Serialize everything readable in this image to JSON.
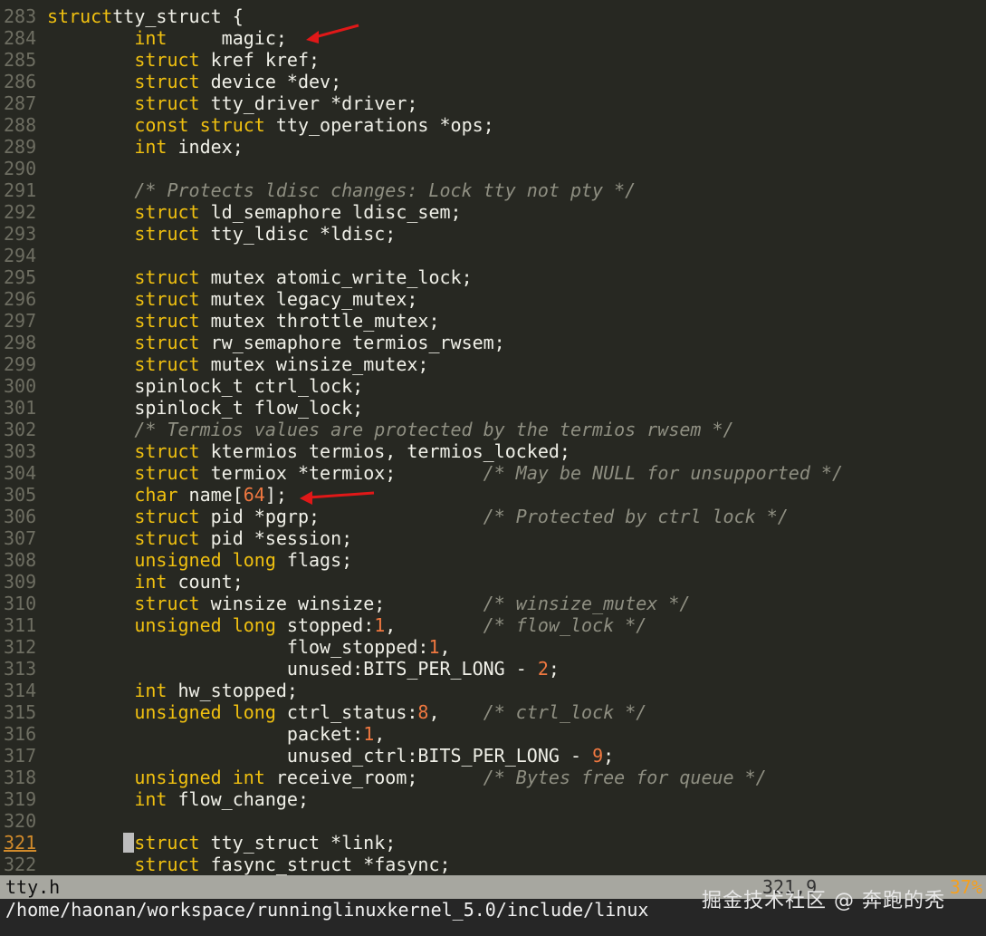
{
  "editor": {
    "lines": [
      {
        "n": "283",
        "parts": [
          [
            "kw",
            "struct"
          ],
          [
            "",
            "tty_struct {"
          ]
        ]
      },
      {
        "n": "284",
        "parts": [
          [
            "",
            "        "
          ],
          [
            "kw",
            "int"
          ],
          [
            "",
            "     magic;"
          ]
        ]
      },
      {
        "n": "285",
        "parts": [
          [
            "",
            "        "
          ],
          [
            "kw",
            "struct"
          ],
          [
            "",
            " kref kref;"
          ]
        ]
      },
      {
        "n": "286",
        "parts": [
          [
            "",
            "        "
          ],
          [
            "kw",
            "struct"
          ],
          [
            "",
            " device *dev;"
          ]
        ]
      },
      {
        "n": "287",
        "parts": [
          [
            "",
            "        "
          ],
          [
            "kw",
            "struct"
          ],
          [
            "",
            " tty_driver *driver;"
          ]
        ]
      },
      {
        "n": "288",
        "parts": [
          [
            "",
            "        "
          ],
          [
            "kw",
            "const"
          ],
          [
            "",
            " "
          ],
          [
            "kw",
            "struct"
          ],
          [
            "",
            " tty_operations *ops;"
          ]
        ]
      },
      {
        "n": "289",
        "parts": [
          [
            "",
            "        "
          ],
          [
            "kw",
            "int"
          ],
          [
            "",
            " index;"
          ]
        ]
      },
      {
        "n": "290",
        "parts": []
      },
      {
        "n": "291",
        "parts": [
          [
            "",
            "        "
          ],
          [
            "cm",
            "/* Protects ldisc changes: Lock tty not pty */"
          ]
        ]
      },
      {
        "n": "292",
        "parts": [
          [
            "",
            "        "
          ],
          [
            "kw",
            "struct"
          ],
          [
            "",
            " ld_semaphore ldisc_sem;"
          ]
        ]
      },
      {
        "n": "293",
        "parts": [
          [
            "",
            "        "
          ],
          [
            "kw",
            "struct"
          ],
          [
            "",
            " tty_ldisc *ldisc;"
          ]
        ]
      },
      {
        "n": "294",
        "parts": []
      },
      {
        "n": "295",
        "parts": [
          [
            "",
            "        "
          ],
          [
            "kw",
            "struct"
          ],
          [
            "",
            " mutex atomic_write_lock;"
          ]
        ]
      },
      {
        "n": "296",
        "parts": [
          [
            "",
            "        "
          ],
          [
            "kw",
            "struct"
          ],
          [
            "",
            " mutex legacy_mutex;"
          ]
        ]
      },
      {
        "n": "297",
        "parts": [
          [
            "",
            "        "
          ],
          [
            "kw",
            "struct"
          ],
          [
            "",
            " mutex throttle_mutex;"
          ]
        ]
      },
      {
        "n": "298",
        "parts": [
          [
            "",
            "        "
          ],
          [
            "kw",
            "struct"
          ],
          [
            "",
            " rw_semaphore termios_rwsem;"
          ]
        ]
      },
      {
        "n": "299",
        "parts": [
          [
            "",
            "        "
          ],
          [
            "kw",
            "struct"
          ],
          [
            "",
            " mutex winsize_mutex;"
          ]
        ]
      },
      {
        "n": "300",
        "parts": [
          [
            "",
            "        spinlock_t ctrl_lock;"
          ]
        ]
      },
      {
        "n": "301",
        "parts": [
          [
            "",
            "        spinlock_t flow_lock;"
          ]
        ]
      },
      {
        "n": "302",
        "parts": [
          [
            "",
            "        "
          ],
          [
            "cm",
            "/* Termios values are protected by the termios rwsem */"
          ]
        ]
      },
      {
        "n": "303",
        "parts": [
          [
            "",
            "        "
          ],
          [
            "kw",
            "struct"
          ],
          [
            "",
            " ktermios termios, termios_locked;"
          ]
        ]
      },
      {
        "n": "304",
        "parts": [
          [
            "",
            "        "
          ],
          [
            "kw",
            "struct"
          ],
          [
            "",
            " termiox *termiox;        "
          ],
          [
            "cm",
            "/* May be NULL for unsupported */"
          ]
        ]
      },
      {
        "n": "305",
        "parts": [
          [
            "",
            "        "
          ],
          [
            "kw",
            "char"
          ],
          [
            "",
            " name["
          ],
          [
            "num",
            "64"
          ],
          [
            "",
            "];"
          ]
        ]
      },
      {
        "n": "306",
        "parts": [
          [
            "",
            "        "
          ],
          [
            "kw",
            "struct"
          ],
          [
            "",
            " pid *pgrp;               "
          ],
          [
            "cm",
            "/* Protected by ctrl lock */"
          ]
        ]
      },
      {
        "n": "307",
        "parts": [
          [
            "",
            "        "
          ],
          [
            "kw",
            "struct"
          ],
          [
            "",
            " pid *session;"
          ]
        ]
      },
      {
        "n": "308",
        "parts": [
          [
            "",
            "        "
          ],
          [
            "kw",
            "unsigned"
          ],
          [
            "",
            " "
          ],
          [
            "kw",
            "long"
          ],
          [
            "",
            " flags;"
          ]
        ]
      },
      {
        "n": "309",
        "parts": [
          [
            "",
            "        "
          ],
          [
            "kw",
            "int"
          ],
          [
            "",
            " count;"
          ]
        ]
      },
      {
        "n": "310",
        "parts": [
          [
            "",
            "        "
          ],
          [
            "kw",
            "struct"
          ],
          [
            "",
            " winsize winsize;         "
          ],
          [
            "cm",
            "/* winsize_mutex */"
          ]
        ]
      },
      {
        "n": "311",
        "parts": [
          [
            "",
            "        "
          ],
          [
            "kw",
            "unsigned"
          ],
          [
            "",
            " "
          ],
          [
            "kw",
            "long"
          ],
          [
            "",
            " stopped:"
          ],
          [
            "num",
            "1"
          ],
          [
            "",
            ",        "
          ],
          [
            "cm",
            "/* flow_lock */"
          ]
        ]
      },
      {
        "n": "312",
        "parts": [
          [
            "",
            "                      flow_stopped:"
          ],
          [
            "num",
            "1"
          ],
          [
            "",
            ","
          ]
        ]
      },
      {
        "n": "313",
        "parts": [
          [
            "",
            "                      unused:BITS_PER_LONG - "
          ],
          [
            "num",
            "2"
          ],
          [
            "",
            ";"
          ]
        ]
      },
      {
        "n": "314",
        "parts": [
          [
            "",
            "        "
          ],
          [
            "kw",
            "int"
          ],
          [
            "",
            " hw_stopped;"
          ]
        ]
      },
      {
        "n": "315",
        "parts": [
          [
            "",
            "        "
          ],
          [
            "kw",
            "unsigned"
          ],
          [
            "",
            " "
          ],
          [
            "kw",
            "long"
          ],
          [
            "",
            " ctrl_status:"
          ],
          [
            "num",
            "8"
          ],
          [
            "",
            ",    "
          ],
          [
            "cm",
            "/* ctrl_lock */"
          ]
        ]
      },
      {
        "n": "316",
        "parts": [
          [
            "",
            "                      packet:"
          ],
          [
            "num",
            "1"
          ],
          [
            "",
            ","
          ]
        ]
      },
      {
        "n": "317",
        "parts": [
          [
            "",
            "                      unused_ctrl:BITS_PER_LONG - "
          ],
          [
            "num",
            "9"
          ],
          [
            "",
            ";"
          ]
        ]
      },
      {
        "n": "318",
        "parts": [
          [
            "",
            "        "
          ],
          [
            "kw",
            "unsigned"
          ],
          [
            "",
            " "
          ],
          [
            "kw",
            "int"
          ],
          [
            "",
            " receive_room;      "
          ],
          [
            "cm",
            "/* Bytes free for queue */"
          ]
        ]
      },
      {
        "n": "319",
        "parts": [
          [
            "",
            "        "
          ],
          [
            "kw",
            "int"
          ],
          [
            "",
            " flow_change;"
          ]
        ]
      },
      {
        "n": "320",
        "parts": []
      },
      {
        "n": "321",
        "current": true,
        "parts": [
          [
            "",
            "       "
          ],
          [
            "cursor",
            ""
          ],
          [
            "kw",
            "struct"
          ],
          [
            "",
            " tty_struct *link;"
          ]
        ]
      },
      {
        "n": "322",
        "parts": [
          [
            "",
            "        "
          ],
          [
            "kw",
            "struct"
          ],
          [
            "",
            " fasync_struct *fasync;"
          ]
        ]
      }
    ]
  },
  "statusbar": {
    "filename": "tty.h",
    "position": "321,9",
    "percent": "37%"
  },
  "cmdline": {
    "path": "/home/haonan/workspace/runninglinuxkernel_5.0/include/linux"
  },
  "watermark": "掘金技术社区 @ 奔跑的秃"
}
